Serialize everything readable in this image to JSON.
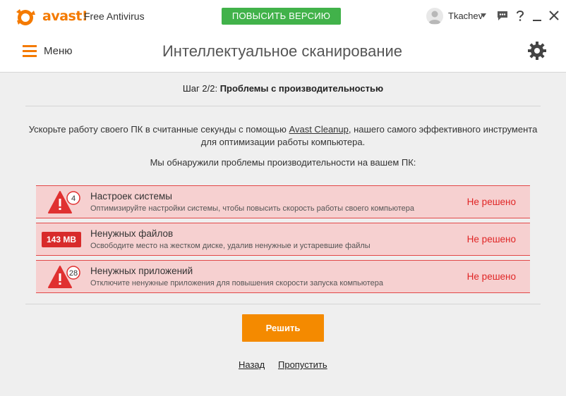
{
  "app": {
    "logo_text": "avast!",
    "product_name": "Free Antivirus",
    "upgrade_label": "ПОВЫСИТЬ ВЕРСИЮ",
    "username": "Tkachev",
    "brand_color": "#f47a00",
    "upgrade_color": "#41b24a",
    "icons": [
      "chat-icon",
      "help-icon",
      "minimize-icon",
      "close-icon"
    ]
  },
  "header": {
    "menu_label": "Меню",
    "title": "Интеллектуальное сканирование",
    "icons": [
      "hamburger-icon",
      "gear-icon"
    ]
  },
  "step": {
    "prefix": "Шаг 2/2:",
    "title": "Проблемы с производительностью"
  },
  "intro": {
    "before": "Ускорьте работу своего ПК в считанные секунды с помощью ",
    "link": "Avast Cleanup",
    "after": ", нашего самого эффективного инструмента для оптимизации работы компьютера."
  },
  "found_text": "Мы обнаружили проблемы производительности на вашем ПК:",
  "issues": [
    {
      "badge": "4",
      "title": "Настроек системы",
      "description": "Оптимизируйте настройки системы, чтобы повысить скорость работы своего компьютера",
      "status": "Не решено",
      "icon": "warning-icon"
    },
    {
      "badge": "143 MB",
      "title": "Ненужных файлов",
      "description": "Освободите место на жестком диске, удалив ненужные и устаревшие файлы",
      "status": "Не решено",
      "icon": "size-badge"
    },
    {
      "badge": "28",
      "title": "Ненужных приложений",
      "description": "Отключите ненужные приложения для повышения скорости запуска компьютера",
      "status": "Не решено",
      "icon": "warning-icon"
    }
  ],
  "status_color": "#e02525",
  "fix_button": "Решить",
  "fix_color": "#f48a00",
  "back_link": "Назад",
  "skip_link": "Пропустить"
}
